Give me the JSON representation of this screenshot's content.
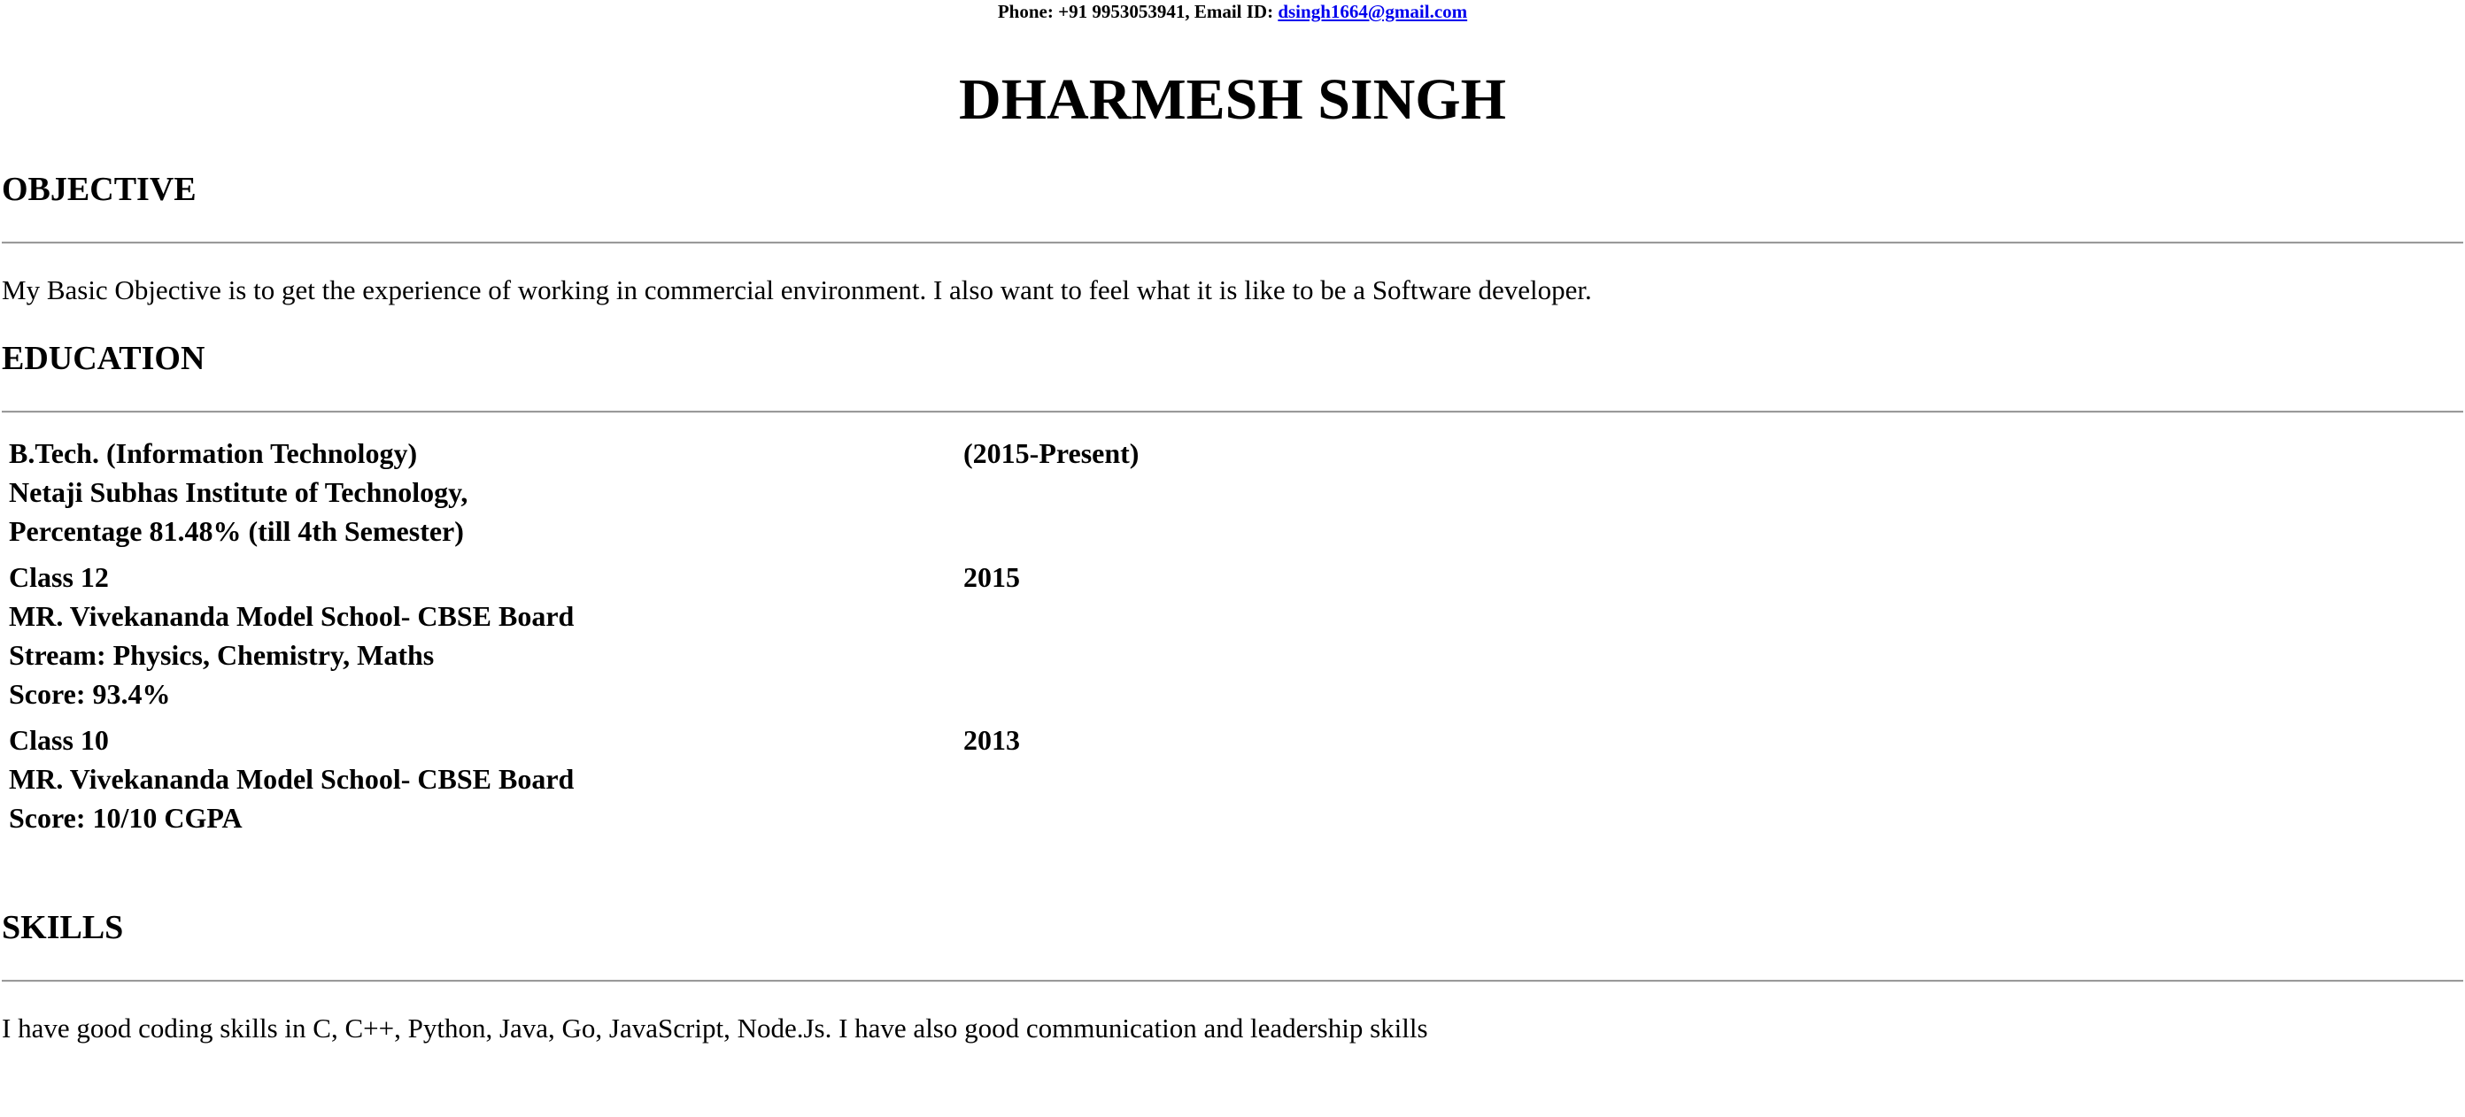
{
  "header": {
    "contact_prefix": "Phone: +91 9953053941, Email ID: ",
    "email": "dsingh1664@gmail.com",
    "name": "DHARMESH SINGH"
  },
  "objective": {
    "heading": "OBJECTIVE",
    "text": "My Basic Objective is to get the experience of working in commercial environment. I also want to feel what it is like to be a Software developer."
  },
  "education": {
    "heading": "EDUCATION",
    "rows": [
      {
        "lines": [
          "B.Tech. (Information Technology)",
          "Netaji Subhas Institute of Technology,",
          "Percentage 81.48% (till 4th Semester)"
        ],
        "period": "(2015-Present)"
      },
      {
        "lines": [
          "Class 12",
          "MR. Vivekananda Model School- CBSE Board",
          "Stream: Physics, Chemistry, Maths",
          "Score: 93.4%"
        ],
        "period": "2015"
      },
      {
        "lines": [
          "Class 10",
          "MR. Vivekananda Model School- CBSE Board",
          "Score: 10/10 CGPA"
        ],
        "period": "2013"
      }
    ]
  },
  "skills": {
    "heading": "SKILLS",
    "text": "I have good coding skills in C, C++, Python, Java, Go, JavaScript, Node.Js. I have also good communication and leadership skills"
  }
}
